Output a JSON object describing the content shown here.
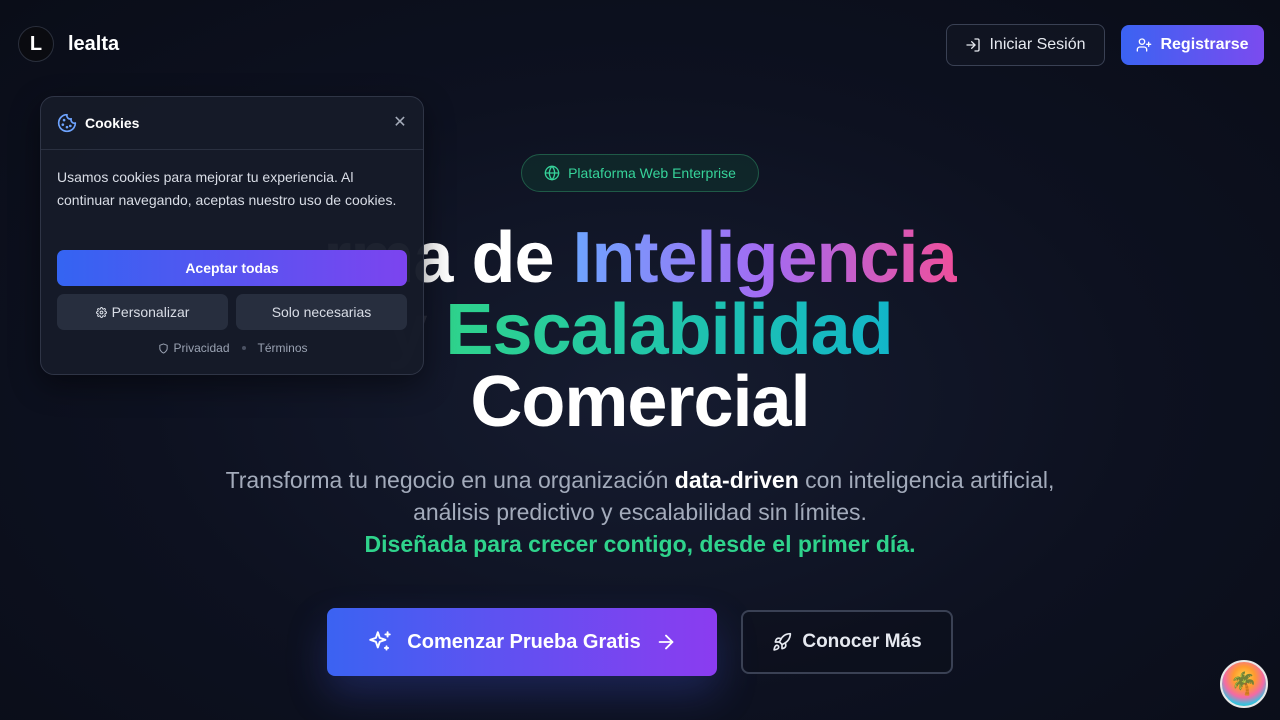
{
  "header": {
    "logo_letter": "L",
    "brand": "lealta",
    "login_label": "Iniciar Sesión",
    "register_label": "Registrarse"
  },
  "hero": {
    "badge": "Plataforma Web Enterprise",
    "title_line1_plain": "rma de ",
    "title_line1_grad": "Inteligencia",
    "title_line2_faint": "y ",
    "title_line2_grad": "Escalabilidad",
    "title_line3": "Comercial",
    "subtitle_pre": "Transforma tu negocio en una organización ",
    "subtitle_bold": "data-driven",
    "subtitle_post": " con inteligencia artificial, análisis predictivo y escalabilidad sin límites.",
    "subtitle_green": "Diseñada para crecer contigo, desde el primer día.",
    "cta_primary": "Comenzar Prueba Gratis",
    "cta_secondary": "Conocer Más"
  },
  "cookies": {
    "title": "Cookies",
    "text": "Usamos cookies para mejorar tu experiencia. Al continuar navegando, aceptas nuestro uso de cookies.",
    "accept_all": "Aceptar todas",
    "customize": "Personalizar",
    "only_necessary": "Solo necesarias",
    "privacy": "Privacidad",
    "terms": "Términos"
  },
  "colors": {
    "accent_blue": "#3b63f2",
    "accent_purple": "#8b3cf0",
    "accent_green": "#2fd38c",
    "background": "#0d1120"
  }
}
